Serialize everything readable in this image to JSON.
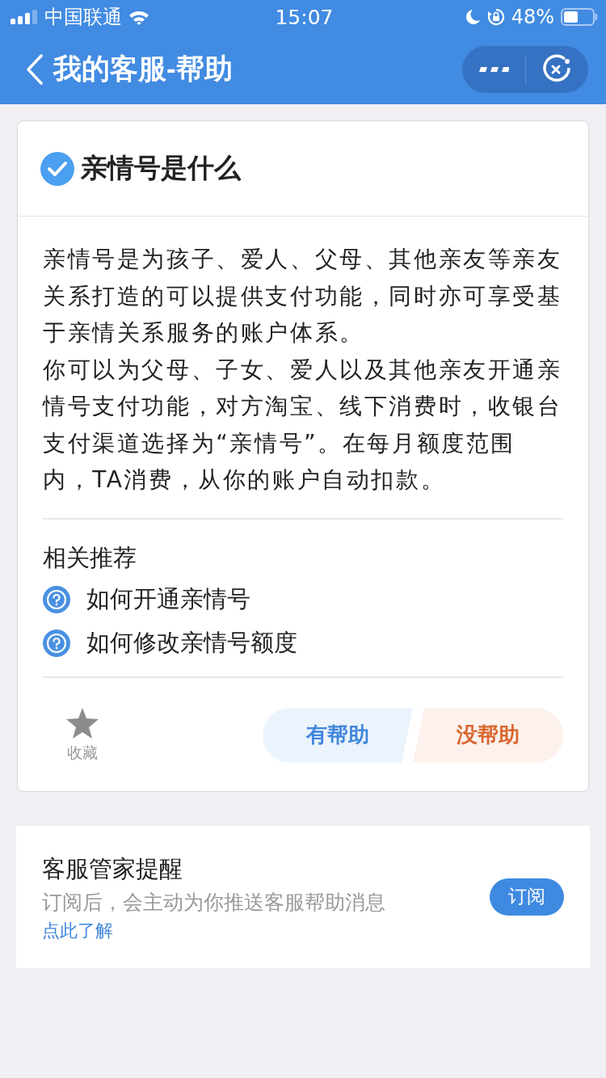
{
  "status_bar": {
    "carrier": "中国联通",
    "time": "15:07",
    "battery": "48%"
  },
  "nav": {
    "back_title": "我的客服-帮助"
  },
  "article": {
    "title": "亲情号是什么",
    "paragraphs": [
      "亲情号是为孩子、爱人、父母、其他亲友等亲友关系打造的可以提供支付功能，同时亦可享受基于亲情关系服务的账户体系。",
      "你可以为父母、子女、爱人以及其他亲友开通亲情号支付功能，对方淘宝、线下消费时，收银台支付渠道选择为“亲情号”。在每月额度范围内，TA消费，从你的账户自动扣款。"
    ],
    "related_title": "相关推荐",
    "related": [
      "如何开通亲情号",
      "如何修改亲情号额度"
    ],
    "favorite": {
      "label": "收藏",
      "selected": false
    },
    "helpful": "有帮助",
    "not_helpful": "没帮助"
  },
  "reminder": {
    "title": "客服管家提醒",
    "description": "订阅后，会主动为你推送客服帮助消息",
    "link": "点此了解",
    "button": "订阅"
  }
}
